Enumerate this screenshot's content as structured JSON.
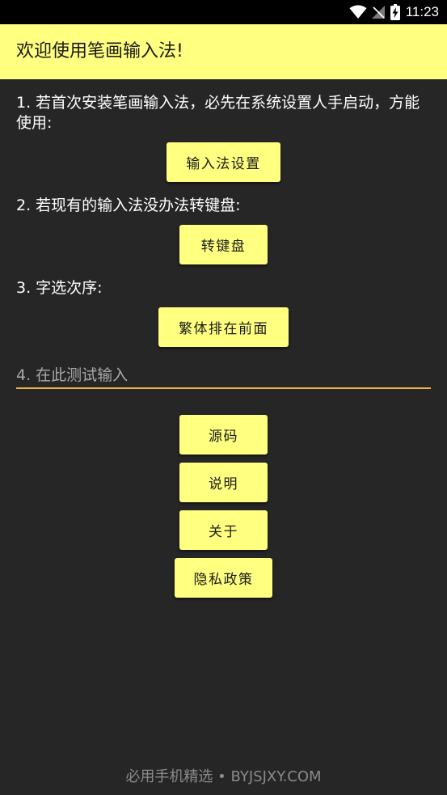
{
  "status_bar": {
    "time": "11:23",
    "icons": [
      "wifi-icon",
      "no-signal-icon",
      "battery-charging-icon"
    ]
  },
  "app_bar": {
    "title": "欢迎使用笔画输入法!"
  },
  "steps": {
    "step1_text": "1. 若首次安装笔画输入法，必先在系统设置人手启动，方能使用:",
    "step1_button": "输入法设置",
    "step2_text": "2. 若现有的输入法没办法转键盘:",
    "step2_button": "转键盘",
    "step3_text": "3. 字选次序:",
    "step3_button": "繁体排在前面",
    "step4_placeholder": "4. 在此测试输入",
    "step4_value": ""
  },
  "links": {
    "source": "源码",
    "manual": "说明",
    "about": "关于",
    "privacy": "隐私政策"
  },
  "watermark": "必用手机精选 • BYJSJXY.COM",
  "colors": {
    "background": "#262626",
    "accent": "#ffff80",
    "input_underline": "#f2b04e",
    "status_bar": "#000000"
  }
}
